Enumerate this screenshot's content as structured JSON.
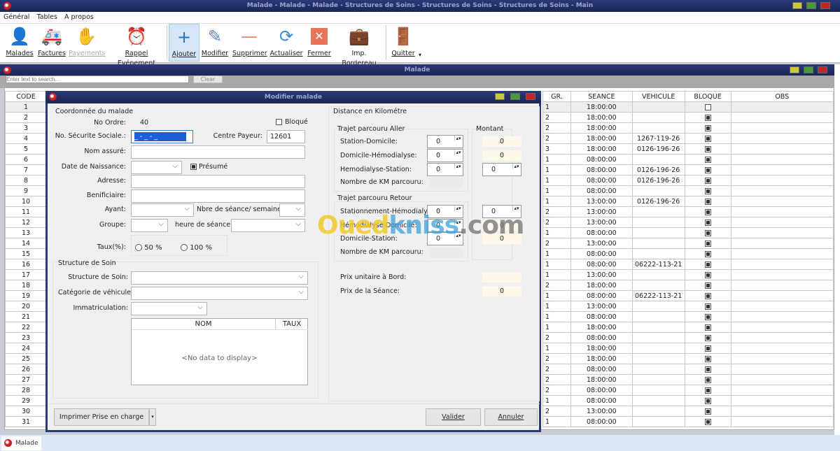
{
  "window": {
    "title": "Malade - Malade - Malade - Structures de Soins - Structures de Soins - Structures de Soins - Main"
  },
  "menu": [
    "Général",
    "Tables",
    "A propos"
  ],
  "toolbar": [
    {
      "label": "Malades",
      "icon": "patient-icon"
    },
    {
      "label": "Factures",
      "icon": "ambulance-icon"
    },
    {
      "label": "Payements",
      "icon": "payment-icon"
    },
    {
      "label": "Rappel Evénement",
      "icon": "alarm-clock-icon"
    },
    {
      "label": "Ajouter",
      "icon": "plus-icon"
    },
    {
      "label": "Modifier",
      "icon": "pencil-icon"
    },
    {
      "label": "Supprimer",
      "icon": "minus-icon"
    },
    {
      "label": "Actualiser",
      "icon": "refresh-icon"
    },
    {
      "label": "Fermer",
      "icon": "close-icon"
    },
    {
      "label": "Imp. Bordereau",
      "icon": "printer-icon"
    },
    {
      "label": "Quitter",
      "icon": "door-icon"
    }
  ],
  "child": {
    "title": "Malade",
    "search_placeholder": "Enter text to search...",
    "clear": "Clear"
  },
  "grid": {
    "columns": [
      "CODE",
      "GR.",
      "SEANCE",
      "VEHICULE",
      "BLOQUE",
      "OBS"
    ],
    "rows": [
      [
        "1",
        "1",
        "18:00:00",
        "",
        false
      ],
      [
        "2",
        "2",
        "18:00:00",
        "",
        true
      ],
      [
        "3",
        "2",
        "18:00:00",
        "",
        true
      ],
      [
        "4",
        "2",
        "18:00:00",
        "1267-119-26",
        true
      ],
      [
        "5",
        "3",
        "18:00:00",
        "0126-196-26",
        true
      ],
      [
        "6",
        "1",
        "08:00:00",
        "",
        true
      ],
      [
        "7",
        "1",
        "08:00:00",
        "0126-196-26",
        true
      ],
      [
        "8",
        "1",
        "08:00:00",
        "0126-196-26",
        true
      ],
      [
        "9",
        "1",
        "08:00:00",
        "",
        true
      ],
      [
        "10",
        "1",
        "13:00:00",
        "0126-196-26",
        true
      ],
      [
        "11",
        "2",
        "13:00:00",
        "",
        true
      ],
      [
        "12",
        "2",
        "13:00:00",
        "",
        true
      ],
      [
        "13",
        "1",
        "08:00:00",
        "",
        true
      ],
      [
        "14",
        "2",
        "13:00:00",
        "",
        true
      ],
      [
        "15",
        "1",
        "08:00:00",
        "",
        true
      ],
      [
        "16",
        "1",
        "08:00:00",
        "06222-113-21",
        true
      ],
      [
        "17",
        "1",
        "13:00:00",
        "",
        true
      ],
      [
        "18",
        "2",
        "18:00:00",
        "",
        true
      ],
      [
        "19",
        "1",
        "08:00:00",
        "06222-113-21",
        true
      ],
      [
        "20",
        "1",
        "13:00:00",
        "",
        true
      ],
      [
        "21",
        "1",
        "08:00:00",
        "",
        true
      ],
      [
        "22",
        "1",
        "18:00:00",
        "",
        true
      ],
      [
        "23",
        "2",
        "08:00:00",
        "",
        true
      ],
      [
        "24",
        "1",
        "18:00:00",
        "",
        true
      ],
      [
        "25",
        "2",
        "18:00:00",
        "",
        true
      ],
      [
        "26",
        "2",
        "08:00:00",
        "",
        true
      ],
      [
        "27",
        "2",
        "18:00:00",
        "",
        true
      ],
      [
        "28",
        "2",
        "08:00:00",
        "",
        true
      ],
      [
        "29",
        "1",
        "08:00:00",
        "",
        true
      ],
      [
        "30",
        "2",
        "13:00:00",
        "",
        true
      ],
      [
        "31",
        "1",
        "08:00:00",
        "",
        true
      ]
    ]
  },
  "dialog": {
    "title": "Modifier malade",
    "coord": {
      "title": "Coordonnée du malade",
      "no_ordre_label": "No Ordre:",
      "no_ordre": "40",
      "bloque": "Bloqué",
      "secu_label": "No. Sécurite Sociale.:",
      "secu_value": "_ - _ - _",
      "centre_label": "Centre Payeur:",
      "centre_value": "12601",
      "nom_label": "Nom assuré:",
      "date_label": "Date de Naissance:",
      "presume": "Présumé",
      "adresse_label": "Adresse:",
      "benif_label": "Benificiaire:",
      "ayant_label": "Ayant:",
      "nbre_label": "Nbre de séance/ semaine:",
      "groupe_label": "Groupe:",
      "heure_label": "heure de séance:",
      "taux_label": "Taux(%):",
      "taux_50": "50 %",
      "taux_100": "100 %"
    },
    "structure": {
      "title": "Structure de Soin",
      "structure_label": "Structure de Soin:",
      "categorie_label": "Catégorie de véhicule:",
      "immat_label": "Immatriculation:",
      "col_nom": "NOM",
      "col_taux": "TAUX",
      "empty": "<No data to display>"
    },
    "distance": {
      "title": "Distance en Kilométre",
      "aller_title": "Trajet parcouru Aller",
      "montant": "Montant",
      "aller": [
        {
          "label": "Station-Domicile:",
          "km": "0",
          "montant": "0"
        },
        {
          "label": "Domicile-Hémodialyse:",
          "km": "0",
          "montant": "0"
        },
        {
          "label": "Hemodialyse-Station:",
          "km": "0",
          "montant": "0"
        }
      ],
      "nb_km": "Nombre de KM parcouru:",
      "retour_title": "Trajet parcouru Retour",
      "retour": [
        {
          "label": "Stationnement-Hémodialyse:",
          "km": "0",
          "montant": "0"
        },
        {
          "label": "Hémodialyse-Domicile:",
          "km": "0",
          "montant": "0"
        },
        {
          "label": "Domicile-Station:",
          "km": "0",
          "montant": "0"
        }
      ],
      "prix_unit": "Prix unitaire à Bord:",
      "prix_seance": "Prix de la Séance:",
      "prix_seance_value": "0"
    },
    "buttons": {
      "imprimer": "Imprimer Prise en charge",
      "valider": "Valider",
      "annuler": "Annuler"
    }
  },
  "watermark": "Ouedkniss.com",
  "taskbar": {
    "tab": "Malade"
  }
}
